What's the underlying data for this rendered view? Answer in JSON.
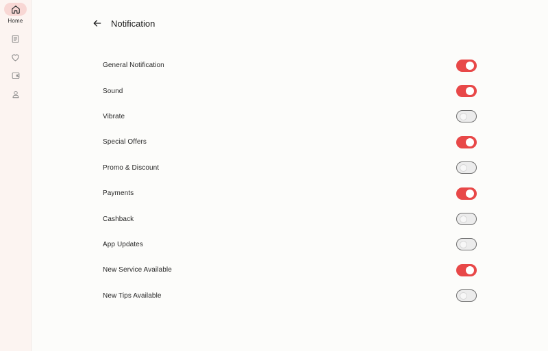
{
  "sidebar": {
    "items": [
      {
        "icon": "home-icon",
        "label": "Home",
        "active": true
      },
      {
        "icon": "document-icon",
        "label": "",
        "active": false
      },
      {
        "icon": "heart-icon",
        "label": "",
        "active": false
      },
      {
        "icon": "wallet-icon",
        "label": "",
        "active": false
      },
      {
        "icon": "profile-icon",
        "label": "",
        "active": false
      }
    ]
  },
  "header": {
    "back_icon": "arrow-left-icon",
    "title": "Notification"
  },
  "colors": {
    "accent": "#e84848",
    "rail_background": "#fcf4f1",
    "active_pill": "#f8d7d4"
  },
  "settings": [
    {
      "label": "General Notification",
      "enabled": true
    },
    {
      "label": "Sound",
      "enabled": true
    },
    {
      "label": "Vibrate",
      "enabled": false
    },
    {
      "label": "Special Offers",
      "enabled": true
    },
    {
      "label": "Promo & Discount",
      "enabled": false
    },
    {
      "label": "Payments",
      "enabled": true
    },
    {
      "label": "Cashback",
      "enabled": false
    },
    {
      "label": "App Updates",
      "enabled": false
    },
    {
      "label": "New Service Available",
      "enabled": true
    },
    {
      "label": "New Tips Available",
      "enabled": false
    }
  ]
}
